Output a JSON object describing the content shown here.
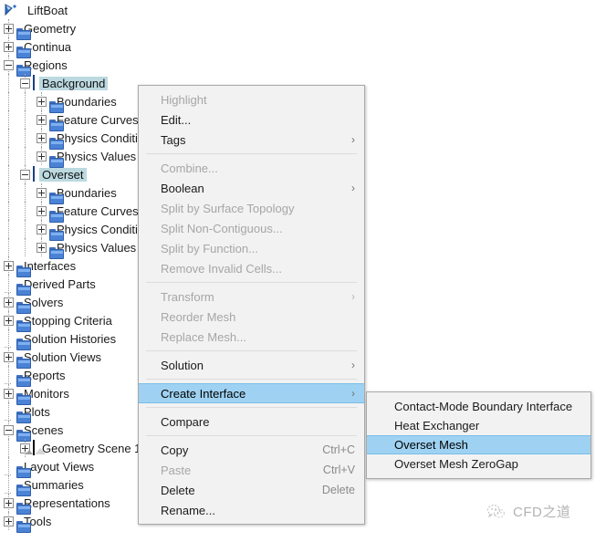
{
  "tree": {
    "root": {
      "label": "LiftBoat",
      "icon": "simulation-icon"
    },
    "items": [
      {
        "label": "Geometry",
        "icon": "folder-icon",
        "depth": 1,
        "expander": "plus"
      },
      {
        "label": "Continua",
        "icon": "folder-icon",
        "depth": 1,
        "expander": "plus"
      },
      {
        "label": "Regions",
        "icon": "folder-icon",
        "depth": 1,
        "expander": "minus"
      },
      {
        "label": "Background",
        "icon": "mesh-icon",
        "depth": 2,
        "expander": "minus",
        "selected": true
      },
      {
        "label": "Boundaries",
        "icon": "folder-icon",
        "depth": 3,
        "expander": "plus"
      },
      {
        "label": "Feature Curves",
        "icon": "folder-icon",
        "depth": 3,
        "expander": "plus"
      },
      {
        "label": "Physics Conditions",
        "icon": "folder-icon",
        "depth": 3,
        "expander": "plus"
      },
      {
        "label": "Physics Values",
        "icon": "folder-icon",
        "depth": 3,
        "expander": "plus"
      },
      {
        "label": "Overset",
        "icon": "mesh-icon",
        "depth": 2,
        "expander": "minus",
        "selected": true
      },
      {
        "label": "Boundaries",
        "icon": "folder-icon",
        "depth": 3,
        "expander": "plus"
      },
      {
        "label": "Feature Curves",
        "icon": "folder-icon",
        "depth": 3,
        "expander": "plus"
      },
      {
        "label": "Physics Conditions",
        "icon": "folder-icon",
        "depth": 3,
        "expander": "plus"
      },
      {
        "label": "Physics Values",
        "icon": "folder-icon",
        "depth": 3,
        "expander": "plus"
      },
      {
        "label": "Interfaces",
        "icon": "folder-icon",
        "depth": 1,
        "expander": "plus"
      },
      {
        "label": "Derived Parts",
        "icon": "folder-icon",
        "depth": 1,
        "expander": "none"
      },
      {
        "label": "Solvers",
        "icon": "folder-icon",
        "depth": 1,
        "expander": "plus"
      },
      {
        "label": "Stopping Criteria",
        "icon": "folder-icon",
        "depth": 1,
        "expander": "plus"
      },
      {
        "label": "Solution Histories",
        "icon": "folder-icon",
        "depth": 1,
        "expander": "none"
      },
      {
        "label": "Solution Views",
        "icon": "folder-icon",
        "depth": 1,
        "expander": "plus"
      },
      {
        "label": "Reports",
        "icon": "folder-icon",
        "depth": 1,
        "expander": "none"
      },
      {
        "label": "Monitors",
        "icon": "folder-icon",
        "depth": 1,
        "expander": "plus"
      },
      {
        "label": "Plots",
        "icon": "folder-icon",
        "depth": 1,
        "expander": "none"
      },
      {
        "label": "Scenes",
        "icon": "folder-icon",
        "depth": 1,
        "expander": "minus"
      },
      {
        "label": "Geometry Scene 1",
        "icon": "scene-icon",
        "depth": 2,
        "expander": "plus"
      },
      {
        "label": "Layout Views",
        "icon": "folder-icon",
        "depth": 1,
        "expander": "none"
      },
      {
        "label": "Summaries",
        "icon": "folder-icon",
        "depth": 1,
        "expander": "none"
      },
      {
        "label": "Representations",
        "icon": "folder-icon",
        "depth": 1,
        "expander": "plus"
      },
      {
        "label": "Tools",
        "icon": "folder-icon",
        "depth": 1,
        "expander": "plus"
      }
    ]
  },
  "context_menu": {
    "items": [
      {
        "label": "Highlight",
        "state": "disabled"
      },
      {
        "label": "Edit...",
        "state": "enabled"
      },
      {
        "label": "Tags",
        "state": "enabled",
        "submenu": true
      },
      {
        "type": "separator"
      },
      {
        "label": "Combine...",
        "state": "disabled"
      },
      {
        "label": "Boolean",
        "state": "enabled",
        "submenu": true
      },
      {
        "label": "Split by Surface Topology",
        "state": "disabled"
      },
      {
        "label": "Split Non-Contiguous...",
        "state": "disabled"
      },
      {
        "label": "Split by Function...",
        "state": "disabled"
      },
      {
        "label": "Remove Invalid Cells...",
        "state": "disabled"
      },
      {
        "type": "separator"
      },
      {
        "label": "Transform",
        "state": "disabled",
        "submenu": true
      },
      {
        "label": "Reorder Mesh",
        "state": "disabled"
      },
      {
        "label": "Replace Mesh...",
        "state": "disabled"
      },
      {
        "type": "separator"
      },
      {
        "label": "Solution",
        "state": "enabled",
        "submenu": true
      },
      {
        "type": "separator"
      },
      {
        "label": "Create Interface",
        "state": "highlighted",
        "submenu": true
      },
      {
        "type": "separator"
      },
      {
        "label": "Compare",
        "state": "enabled"
      },
      {
        "type": "separator"
      },
      {
        "label": "Copy",
        "state": "enabled",
        "accel": "Ctrl+C"
      },
      {
        "label": "Paste",
        "state": "disabled",
        "accel": "Ctrl+V"
      },
      {
        "label": "Delete",
        "state": "enabled",
        "accel": "Delete"
      },
      {
        "label": "Rename...",
        "state": "enabled"
      }
    ]
  },
  "submenu": {
    "items": [
      {
        "label": "Contact-Mode Boundary Interface",
        "state": "enabled"
      },
      {
        "label": "Heat Exchanger",
        "state": "enabled"
      },
      {
        "label": "Overset Mesh",
        "state": "highlighted"
      },
      {
        "label": "Overset Mesh ZeroGap",
        "state": "enabled"
      }
    ]
  },
  "watermark": {
    "text": "CFD之道",
    "icon": "wechat-logo-icon"
  },
  "colors": {
    "menu_background": "#f2f2f2",
    "menu_border": "#a9a9a9",
    "highlight": "#9fd2f2",
    "tree_selection": "#bcd9e0",
    "disabled_text": "#a6a6a6",
    "folder_blue": "#4a82d6"
  }
}
